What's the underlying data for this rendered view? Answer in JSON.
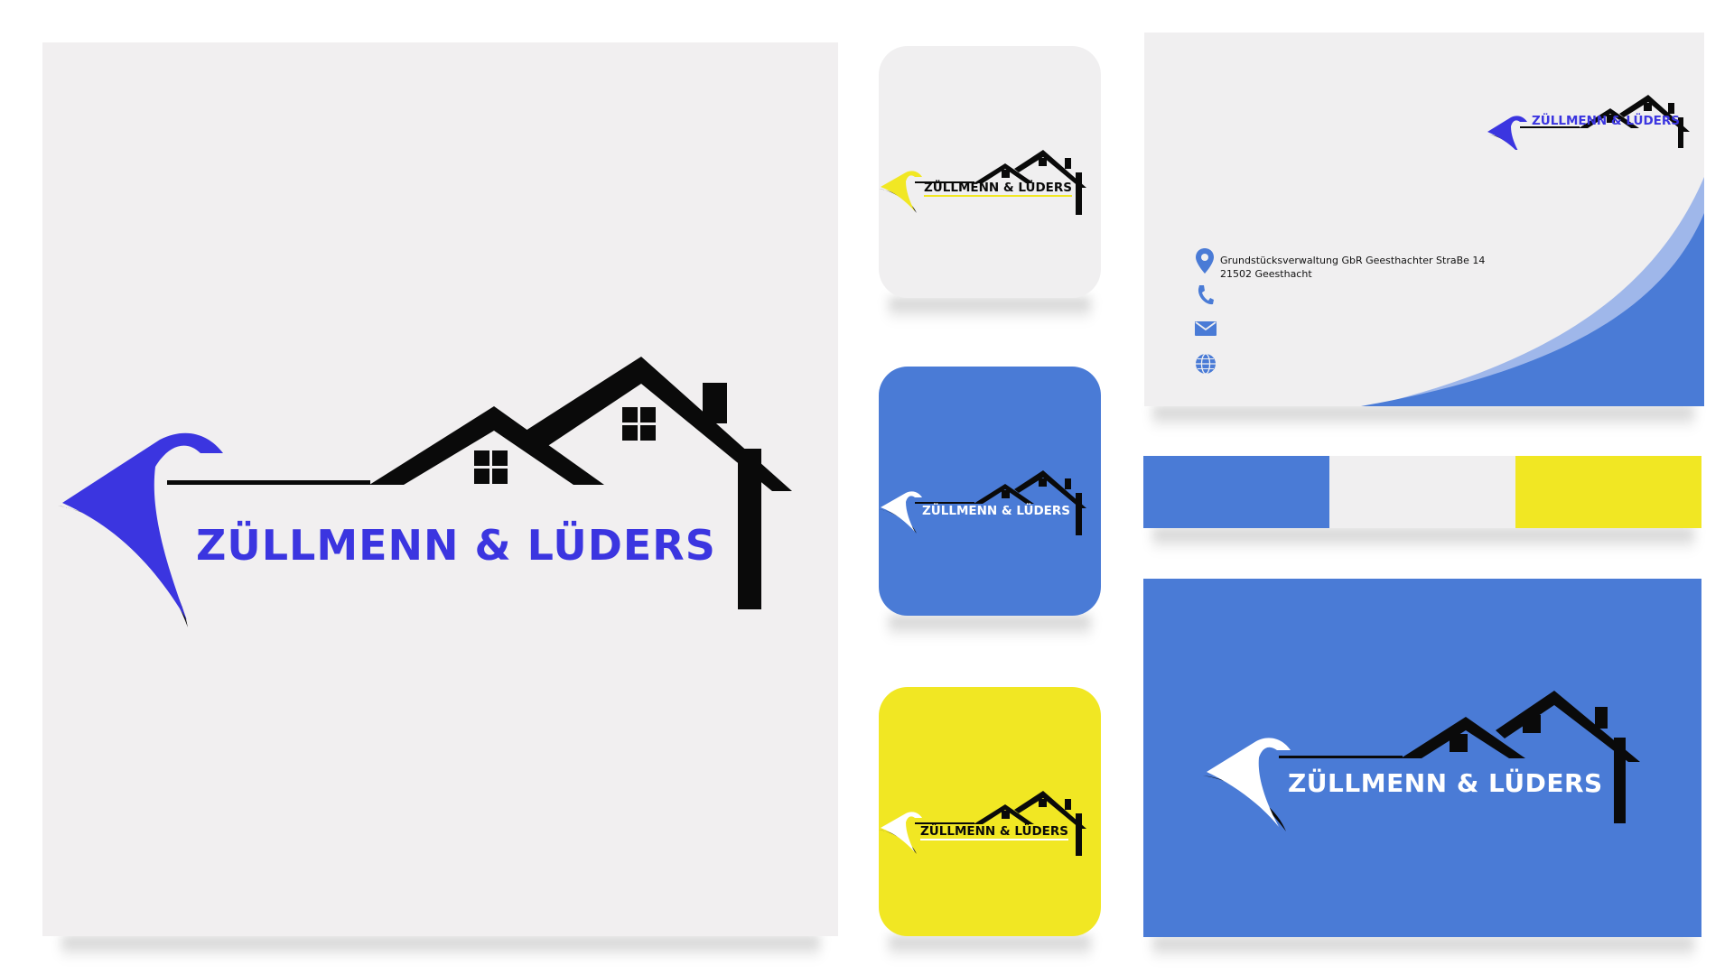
{
  "brand": {
    "name": "ZÜLLMENN & LÜDERS",
    "colors": {
      "primary_blue": "#4a7bd6",
      "logo_blue": "#3b35e0",
      "light_gray": "#f0eff0",
      "yellow": "#f1e723",
      "black": "#0a0a0a",
      "white": "#ffffff"
    }
  },
  "main_card": {
    "logo_text": "ZÜLLMENN & LÜDERS"
  },
  "tiles": [
    {
      "variant": "light",
      "logo_text": "ZÜLLMENN & LÜDERS"
    },
    {
      "variant": "blue",
      "logo_text": "ZÜLLMENN & LÜDERS"
    },
    {
      "variant": "yellow",
      "logo_text": "ZÜLLMENN & LÜDERS"
    }
  ],
  "business_card": {
    "logo_text": "ZÜLLMENN & LÜDERS",
    "address_line1": "Grundstücksverwaltung GbR Geesthachter StraBe 14",
    "address_line2": "21502 Geesthacht",
    "icons": [
      "location-pin-icon",
      "phone-icon",
      "mail-icon",
      "globe-icon"
    ]
  },
  "palette": [
    "#4a7bd6",
    "#f0eff0",
    "#f1e723"
  ],
  "banner": {
    "logo_text": "ZÜLLMENN & LÜDERS"
  }
}
